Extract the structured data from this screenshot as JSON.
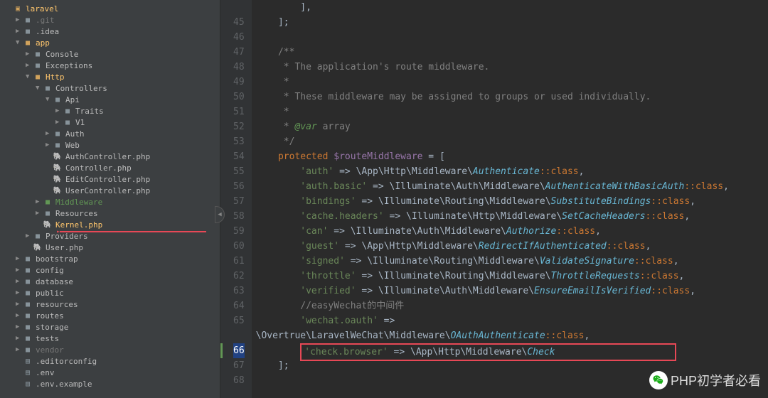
{
  "tree": [
    {
      "indent": 0,
      "chev": "",
      "icon": "root",
      "label": "laravel",
      "cls": "active-file"
    },
    {
      "indent": 1,
      "chev": "▶",
      "icon": "folder",
      "label": ".git",
      "muted": true
    },
    {
      "indent": 1,
      "chev": "▶",
      "icon": "folder",
      "label": ".idea"
    },
    {
      "indent": 1,
      "chev": "▼",
      "icon": "folder-open",
      "label": "app",
      "cls": "active-file"
    },
    {
      "indent": 2,
      "chev": "▶",
      "icon": "folder",
      "label": "Console"
    },
    {
      "indent": 2,
      "chev": "▶",
      "icon": "folder",
      "label": "Exceptions"
    },
    {
      "indent": 2,
      "chev": "▼",
      "icon": "folder-open",
      "label": "Http",
      "cls": "active-file"
    },
    {
      "indent": 3,
      "chev": "▼",
      "icon": "folder",
      "label": "Controllers"
    },
    {
      "indent": 4,
      "chev": "▼",
      "icon": "folder",
      "label": "Api"
    },
    {
      "indent": 5,
      "chev": "▶",
      "icon": "folder",
      "label": "Traits"
    },
    {
      "indent": 5,
      "chev": "▶",
      "icon": "folder",
      "label": "V1"
    },
    {
      "indent": 4,
      "chev": "▶",
      "icon": "folder",
      "label": "Auth"
    },
    {
      "indent": 4,
      "chev": "▶",
      "icon": "folder",
      "label": "Web"
    },
    {
      "indent": 4,
      "chev": "",
      "icon": "php",
      "label": "AuthController.php"
    },
    {
      "indent": 4,
      "chev": "",
      "icon": "php",
      "label": "Controller.php"
    },
    {
      "indent": 4,
      "chev": "",
      "icon": "php",
      "label": "EditController.php"
    },
    {
      "indent": 4,
      "chev": "",
      "icon": "php",
      "label": "UserController.php"
    },
    {
      "indent": 3,
      "chev": "▶",
      "icon": "folder-green",
      "label": "Middleware",
      "cls": "active-file",
      "green": true
    },
    {
      "indent": 3,
      "chev": "▶",
      "icon": "folder",
      "label": "Resources"
    },
    {
      "indent": 3,
      "chev": "",
      "icon": "php",
      "label": "Kernel.php",
      "cls": "active-file",
      "selected": false
    },
    {
      "indent": 2,
      "chev": "▶",
      "icon": "folder",
      "label": "Providers"
    },
    {
      "indent": 2,
      "chev": "",
      "icon": "php",
      "label": "User.php"
    },
    {
      "indent": 1,
      "chev": "▶",
      "icon": "folder",
      "label": "bootstrap"
    },
    {
      "indent": 1,
      "chev": "▶",
      "icon": "folder",
      "label": "config"
    },
    {
      "indent": 1,
      "chev": "▶",
      "icon": "folder",
      "label": "database"
    },
    {
      "indent": 1,
      "chev": "▶",
      "icon": "folder",
      "label": "public"
    },
    {
      "indent": 1,
      "chev": "▶",
      "icon": "folder",
      "label": "resources"
    },
    {
      "indent": 1,
      "chev": "▶",
      "icon": "folder",
      "label": "routes"
    },
    {
      "indent": 1,
      "chev": "▶",
      "icon": "folder",
      "label": "storage"
    },
    {
      "indent": 1,
      "chev": "▶",
      "icon": "folder",
      "label": "tests"
    },
    {
      "indent": 1,
      "chev": "▶",
      "icon": "folder",
      "label": "vendor",
      "muted": true
    },
    {
      "indent": 1,
      "chev": "",
      "icon": "file",
      "label": ".editorconfig"
    },
    {
      "indent": 1,
      "chev": "",
      "icon": "file",
      "label": ".env"
    },
    {
      "indent": 1,
      "chev": "",
      "icon": "file",
      "label": ".env.example",
      "faded": true
    }
  ],
  "code_lines": [
    {
      "n": "",
      "html": "        ],"
    },
    {
      "n": "45",
      "html": "    ];"
    },
    {
      "n": "46",
      "html": ""
    },
    {
      "n": "47",
      "html": "    <span class='c-cmt'>/**</span>"
    },
    {
      "n": "48",
      "html": "    <span class='c-cmt'> * The application's route middleware.</span>"
    },
    {
      "n": "49",
      "html": "    <span class='c-cmt'> *</span>"
    },
    {
      "n": "50",
      "html": "    <span class='c-cmt'> * These middleware may be assigned to groups or used individually.</span>"
    },
    {
      "n": "51",
      "html": "    <span class='c-cmt'> *</span>"
    },
    {
      "n": "52",
      "html": "    <span class='c-cmt'> * <span class='c-tag'>@var</span> array</span>"
    },
    {
      "n": "53",
      "html": "    <span class='c-cmt'> */</span>"
    },
    {
      "n": "54",
      "html": "    <span class='c-kw'>protected</span> <span class='c-var'>$routeMiddleware</span> = ["
    },
    {
      "n": "55",
      "html": "        <span class='c-str'>'auth'</span> =&gt; \\App\\Http\\Middleware\\<span class='c-cls'>Authenticate</span><span class='c-const'>::</span><span class='c-kw'>class</span>,"
    },
    {
      "n": "56",
      "html": "        <span class='c-str'>'auth.basic'</span> =&gt; \\Illuminate\\Auth\\Middleware\\<span class='c-cls'>AuthenticateWithBasicAuth</span><span class='c-const'>::</span><span class='c-kw'>class</span>,"
    },
    {
      "n": "57",
      "html": "        <span class='c-str'>'bindings'</span> =&gt; \\Illuminate\\Routing\\Middleware\\<span class='c-cls'>SubstituteBindings</span><span class='c-const'>::</span><span class='c-kw'>class</span>,"
    },
    {
      "n": "58",
      "html": "        <span class='c-str'>'cache.headers'</span> =&gt; \\Illuminate\\Http\\Middleware\\<span class='c-cls'>SetCacheHeaders</span><span class='c-const'>::</span><span class='c-kw'>class</span>,"
    },
    {
      "n": "59",
      "html": "        <span class='c-str'>'can'</span> =&gt; \\Illuminate\\Auth\\Middleware\\<span class='c-cls'>Authorize</span><span class='c-const'>::</span><span class='c-kw'>class</span>,"
    },
    {
      "n": "60",
      "html": "        <span class='c-str'>'guest'</span> =&gt; \\App\\Http\\Middleware\\<span class='c-cls'>RedirectIfAuthenticated</span><span class='c-const'>::</span><span class='c-kw'>class</span>,"
    },
    {
      "n": "61",
      "html": "        <span class='c-str'>'signed'</span> =&gt; \\Illuminate\\Routing\\Middleware\\<span class='c-cls'>ValidateSignature</span><span class='c-const'>::</span><span class='c-kw'>class</span>,"
    },
    {
      "n": "62",
      "html": "        <span class='c-str'>'throttle'</span> =&gt; \\Illuminate\\Routing\\Middleware\\<span class='c-cls'>ThrottleRequests</span><span class='c-const'>::</span><span class='c-kw'>class</span>,"
    },
    {
      "n": "63",
      "html": "        <span class='c-str'>'verified'</span> =&gt; \\Illuminate\\Auth\\Middleware\\<span class='c-cls'>EnsureEmailIsVerified</span><span class='c-const'>::</span><span class='c-kw'>class</span>,"
    },
    {
      "n": "64",
      "html": "        <span class='c-cmt'>//easyWechat的中间件</span>"
    },
    {
      "n": "65",
      "html": "        <span class='c-str'>'wechat.oauth'</span> =&gt;",
      "dot": true
    },
    {
      "n": "",
      "html": "\\Overtrue\\LaravelWeChat\\Middleware\\<span class='c-cls'>OAuthAuthenticate</span><span class='c-const'>::</span><span class='c-kw'>class</span>,"
    },
    {
      "n": "66",
      "box": true,
      "changed": true,
      "html": "        <span class='redbox'><span class='c-str'>'check.browser'</span> =&gt; \\App\\Http\\Middleware\\<span class='c-cls'>Check</span>                     </span>"
    },
    {
      "n": "67",
      "html": "    ];"
    },
    {
      "n": "68",
      "html": ""
    }
  ],
  "watermark": "PHP初学者必看"
}
